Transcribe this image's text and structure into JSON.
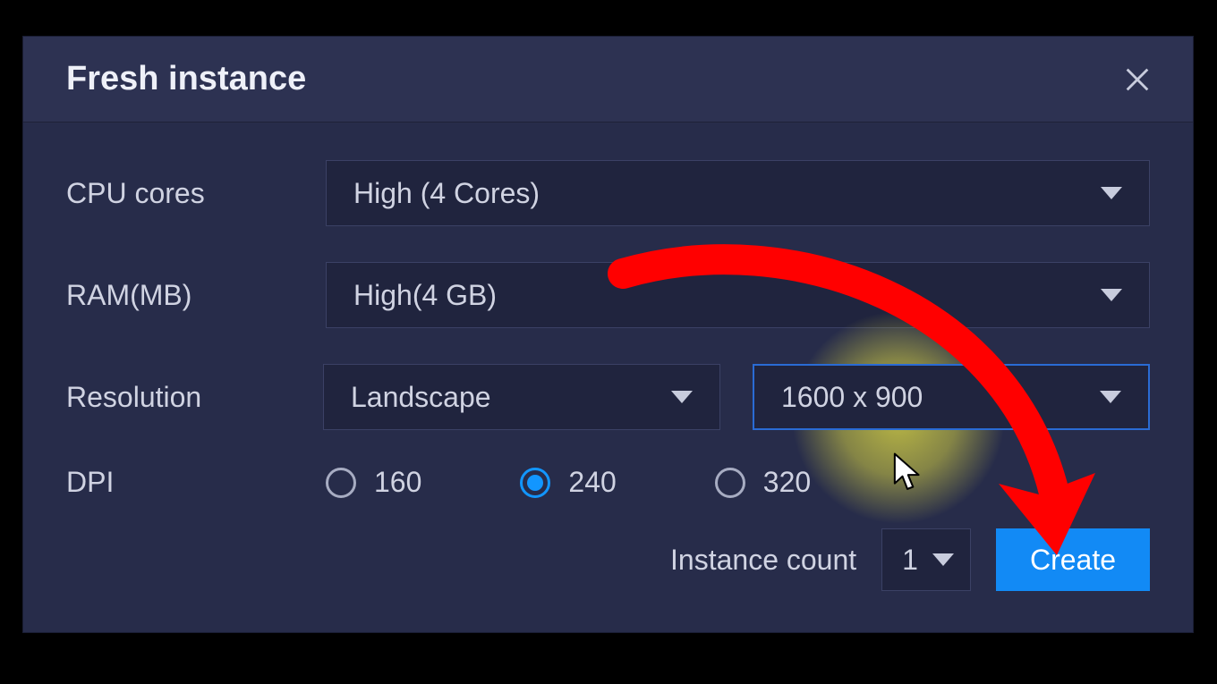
{
  "dialog": {
    "title": "Fresh instance",
    "rows": {
      "cpu": {
        "label": "CPU cores",
        "value": "High (4 Cores)"
      },
      "ram": {
        "label": "RAM(MB)",
        "value": "High(4 GB)"
      },
      "resolution": {
        "label": "Resolution",
        "orientation": "Landscape",
        "size": "1600 x 900"
      },
      "dpi": {
        "label": "DPI",
        "options": [
          "160",
          "240",
          "320"
        ],
        "selected": "240"
      }
    },
    "footer": {
      "instance_count_label": "Instance count",
      "instance_count_value": "1",
      "create_label": "Create"
    }
  },
  "annotation": {
    "type": "arrow",
    "target": "create-button",
    "highlight_target": "resolution-size-select"
  }
}
